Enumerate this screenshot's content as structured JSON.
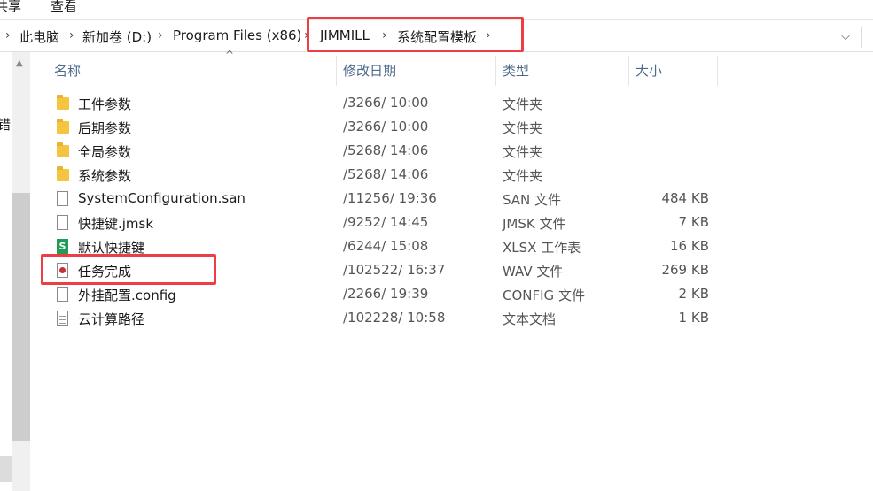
{
  "ribbon": {
    "tabs": [
      "共享",
      "查看"
    ]
  },
  "address": {
    "crumbs": [
      "此电脑",
      "新加卷 (D:)",
      "Program Files (x86)",
      "JIMMILL",
      "系统配置模板"
    ]
  },
  "nav": {
    "partial_text": "错"
  },
  "columns": {
    "name": "名称",
    "date": "修改日期",
    "type": "类型",
    "size": "大小"
  },
  "files": [
    {
      "icon": "folder-icon",
      "name": "工件参数",
      "date": "/3266/ 10:00",
      "type": "文件夹",
      "size": ""
    },
    {
      "icon": "folder-icon",
      "name": "后期参数",
      "date": "/3266/ 10:00",
      "type": "文件夹",
      "size": ""
    },
    {
      "icon": "folder-icon",
      "name": "全局参数",
      "date": "/5268/ 14:06",
      "type": "文件夹",
      "size": ""
    },
    {
      "icon": "folder-icon",
      "name": "系统参数",
      "date": "/5268/ 14:06",
      "type": "文件夹",
      "size": ""
    },
    {
      "icon": "file-icon",
      "name": "SystemConfiguration.san",
      "date": "/11256/ 19:36",
      "type": "SAN 文件",
      "size": "484 KB"
    },
    {
      "icon": "file-icon",
      "name": "快捷键.jmsk",
      "date": "/9252/ 14:45",
      "type": "JMSK 文件",
      "size": "7 KB"
    },
    {
      "icon": "xlsx-icon",
      "name": "默认快捷键",
      "date": "/6244/ 15:08",
      "type": "XLSX 工作表",
      "size": "16 KB"
    },
    {
      "icon": "wav-icon",
      "name": "任务完成",
      "date": "/102522/ 16:37",
      "type": "WAV 文件",
      "size": "269 KB"
    },
    {
      "icon": "file-icon",
      "name": "外挂配置.config",
      "date": "/2266/ 19:39",
      "type": "CONFIG 文件",
      "size": "2 KB"
    },
    {
      "icon": "txt-icon",
      "name": "云计算路径",
      "date": "/102228/ 10:58",
      "type": "文本文档",
      "size": "1 KB"
    }
  ],
  "colors": {
    "highlight": "#ee3e45",
    "folder": "#f5c542",
    "header_text": "#4d6a8a"
  }
}
